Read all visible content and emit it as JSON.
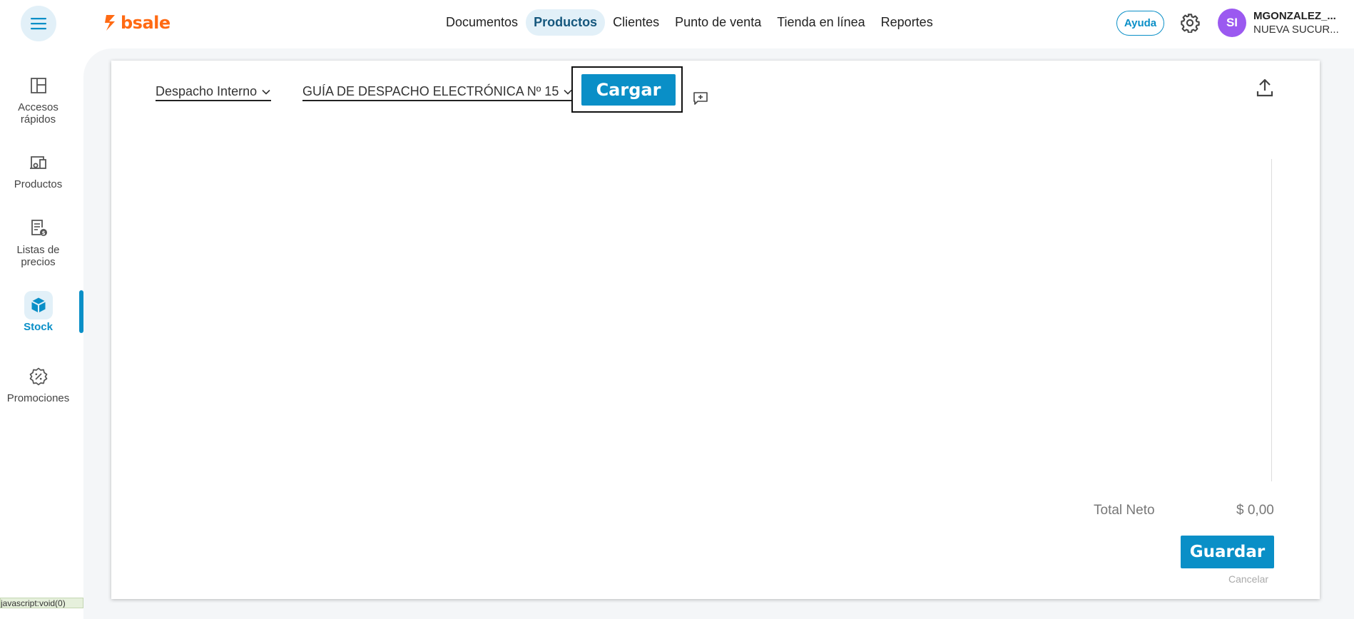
{
  "header": {
    "logo_text": "bsale",
    "nav": [
      {
        "label": "Documentos",
        "active": false
      },
      {
        "label": "Productos",
        "active": true
      },
      {
        "label": "Clientes",
        "active": false
      },
      {
        "label": "Punto de venta",
        "active": false
      },
      {
        "label": "Tienda en línea",
        "active": false
      },
      {
        "label": "Reportes",
        "active": false
      }
    ],
    "help_label": "Ayuda",
    "avatar_initials": "SI",
    "user_name": "MGONZALEZ_...",
    "user_branch": "NUEVA SUCUR..."
  },
  "sidebar": {
    "items": [
      {
        "label": "Accesos rápidos",
        "icon": "dashboard-icon"
      },
      {
        "label": "Productos",
        "icon": "products-icon"
      },
      {
        "label": "Listas de precios",
        "icon": "price-list-icon"
      },
      {
        "label": "Stock",
        "icon": "box-icon",
        "active": true
      },
      {
        "label": "Promociones",
        "icon": "discount-icon"
      }
    ]
  },
  "form": {
    "document_type": "Despacho Interno",
    "document_name": "GUÍA DE DESPACHO ELECTRÓNICA Nº 15",
    "load_button": "Cargar",
    "total_label": "Total Neto",
    "total_value": "$ 0,00",
    "save_button": "Guardar",
    "cancel_label": "Cancelar"
  },
  "status_bar": "javascript:void(0)",
  "colors": {
    "accent": "#0a8fc7",
    "brand": "#ff6a13",
    "avatar": "#9b59f0",
    "active_bg": "#e2f0f8"
  }
}
